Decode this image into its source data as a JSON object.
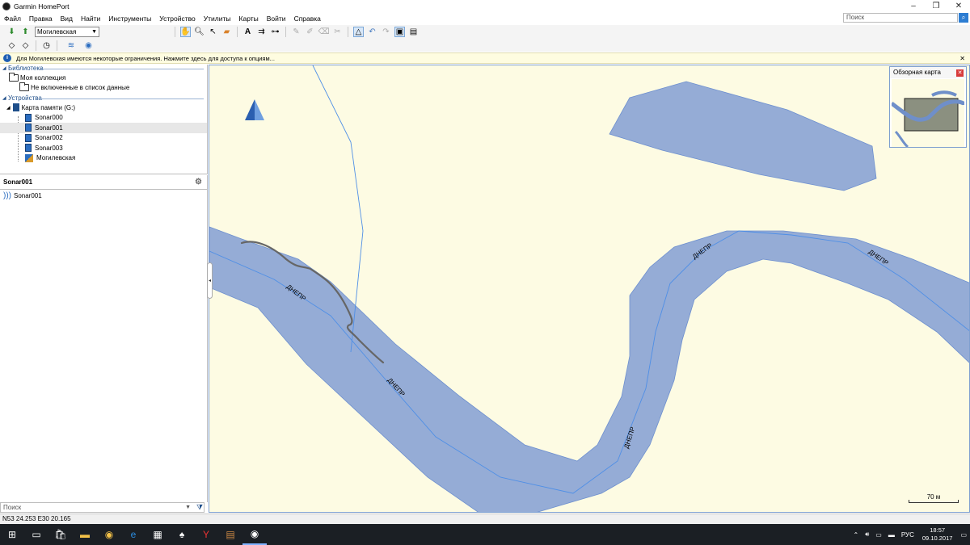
{
  "window": {
    "title": "Garmin HomePort",
    "controls": {
      "minimize": "–",
      "maximize": "❐",
      "close": "✕"
    }
  },
  "menu": {
    "items": [
      "Файл",
      "Правка",
      "Вид",
      "Найти",
      "Инструменты",
      "Устройство",
      "Утилиты",
      "Карты",
      "Войти",
      "Справка"
    ],
    "search_placeholder": "Поиск"
  },
  "toolbar": {
    "map_select_value": "Могилевская"
  },
  "infobar": {
    "text": "Для Могилевская имеются некоторые ограничения. Нажмите здесь для доступа к опциям..."
  },
  "library": {
    "header": "Библиотека",
    "items": [
      {
        "label": "Моя коллекция"
      },
      {
        "label": "Не включенные в список данные"
      }
    ]
  },
  "devices": {
    "header": "Устройства",
    "card_label": "Карта памяти (G:)",
    "files": [
      {
        "label": "Sonar000",
        "selected": false
      },
      {
        "label": "Sonar001",
        "selected": true
      },
      {
        "label": "Sonar002",
        "selected": false
      },
      {
        "label": "Sonar003",
        "selected": false
      }
    ],
    "map_label": "Могилевская"
  },
  "details": {
    "title": "Sonar001",
    "rows": [
      {
        "label": "Sonar001"
      }
    ]
  },
  "left_search": {
    "placeholder": "Поиск"
  },
  "status": {
    "coordinates": "N53 24.253 E30 20.165"
  },
  "map": {
    "river_label": "ДНЕПР",
    "scale_label": "70 м",
    "colors": {
      "land": "#fdfbe3",
      "water": "#95acd6",
      "water_line": "#4f8fe6",
      "track": "#666666"
    }
  },
  "overview": {
    "title": "Обзорная карта",
    "close": "✕"
  },
  "taskbar": {
    "lang": "РУС",
    "time": "18:57",
    "date": "09.10.2017"
  }
}
